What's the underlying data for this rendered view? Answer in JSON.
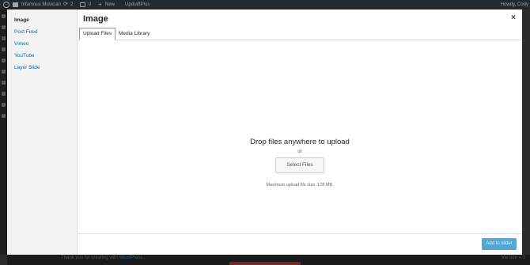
{
  "adminbar": {
    "site_name": "Infamous Musician",
    "updates_count": "2",
    "comments_count": "0",
    "new_label": "New",
    "plugin_label": "UpdraftPlus",
    "howdy": "Howdy, Cody"
  },
  "modal": {
    "title": "Image",
    "close_label": "×",
    "menu": [
      {
        "label": "Image",
        "active": true
      },
      {
        "label": "Post Feed"
      },
      {
        "label": "Vimeo"
      },
      {
        "label": "YouTube"
      },
      {
        "label": "Layer Slide"
      }
    ],
    "tabs": [
      {
        "label": "Upload Files",
        "active": true
      },
      {
        "label": "Media Library"
      }
    ],
    "uploader": {
      "drop_text": "Drop files anywhere to upload",
      "or_text": "or",
      "select_button": "Select Files",
      "max_size": "Maximum upload file size: 128 MB."
    },
    "toolbar": {
      "add_button": "Add to slider"
    }
  },
  "footer": {
    "thanks": "Thank you for creating with",
    "link": "WordPress",
    "version": "Version 4.9"
  }
}
